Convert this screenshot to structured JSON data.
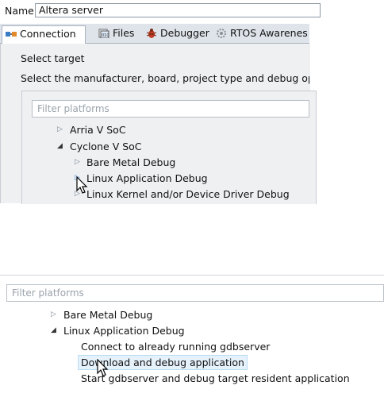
{
  "top": {
    "name_label": "Name:",
    "name_value": "Altera server",
    "tabs": [
      {
        "label": "Connection",
        "icon": "connection-icon",
        "active": true
      },
      {
        "label": "Files",
        "icon": "files-icon",
        "active": false
      },
      {
        "label": "Debugger",
        "icon": "debugger-icon",
        "active": false
      },
      {
        "label": "RTOS Awarenes",
        "icon": "rtos-icon",
        "active": false
      }
    ],
    "select_target_title": "Select target",
    "select_target_desc": "Select the manufacturer, board, project type and debug opera",
    "filter_placeholder": "Filter platforms",
    "tree": [
      {
        "label": "Arria V SoC",
        "expanded": false
      },
      {
        "label": "Cyclone V SoC",
        "expanded": true
      },
      {
        "label": "Bare Metal Debug",
        "expanded": false
      },
      {
        "label": "Linux Application Debug",
        "expanded": false
      },
      {
        "label": "Linux Kernel and/or Device Driver Debug",
        "expanded": false
      }
    ]
  },
  "bottom": {
    "filter_placeholder": "Filter platforms",
    "tree": [
      {
        "label": "Bare Metal Debug",
        "expanded": false
      },
      {
        "label": "Linux Application Debug",
        "expanded": true
      },
      {
        "label": "Connect to already running gdbserver"
      },
      {
        "label": "Download and debug application",
        "selected": true
      },
      {
        "label": "Start gdbserver and debug target resident application"
      }
    ]
  },
  "colors": {
    "tab_bar": "#dfe4ea",
    "panel_bg": "#eef0f2",
    "selection": "#e5f1fb"
  }
}
